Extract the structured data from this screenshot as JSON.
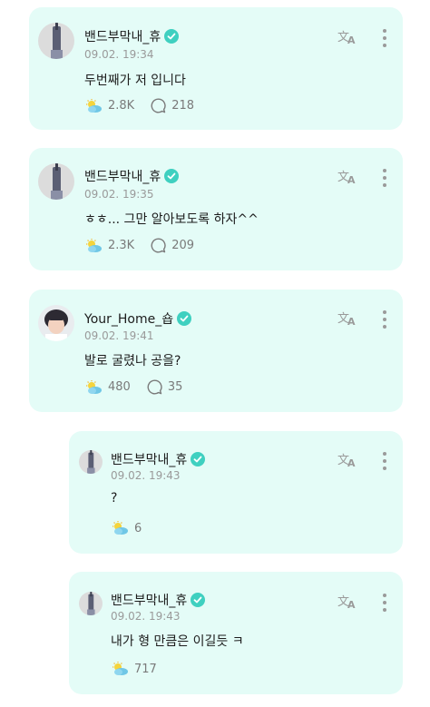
{
  "colors": {
    "card_bg": "#e4fcf7",
    "verified": "#3fd0c0",
    "muted": "#9a9a9a",
    "text": "#1c1c1c"
  },
  "comments": [
    {
      "author": "밴드부막내_휴",
      "time": "09.02. 19:34",
      "text": "두번째가 저 입니다",
      "likes": "2.8K",
      "replies": "218",
      "avatar": "band-member-avatar"
    },
    {
      "author": "밴드부막내_휴",
      "time": "09.02. 19:35",
      "text": "ㅎㅎ... 그만 알아보도록 하자^^",
      "likes": "2.3K",
      "replies": "209",
      "avatar": "band-member-avatar"
    },
    {
      "author": "Your_Home_숍",
      "time": "09.02. 19:41",
      "text": "발로 굴렸나 공을?",
      "likes": "480",
      "replies": "35",
      "avatar": "profile-photo-avatar"
    },
    {
      "author": "밴드부막내_휴",
      "time": "09.02. 19:43",
      "text": "?",
      "likes": "6",
      "avatar": "band-member-avatar"
    },
    {
      "author": "밴드부막내_휴",
      "time": "09.02. 19:43",
      "text": "내가 형 만큼은 이길듯 ㅋ",
      "likes": "717",
      "avatar": "band-member-avatar"
    }
  ]
}
